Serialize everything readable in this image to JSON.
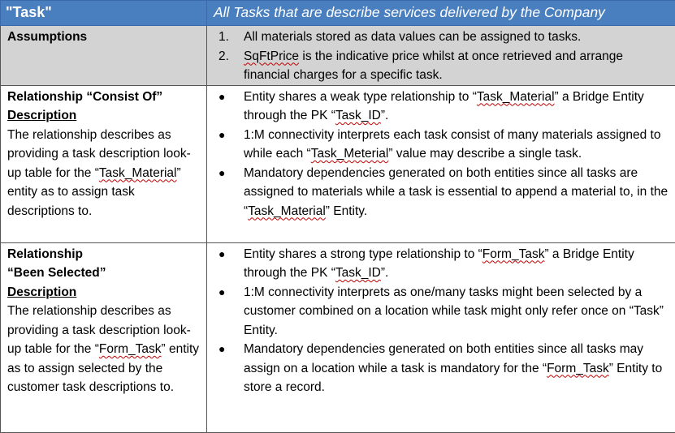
{
  "header": {
    "entity": "\"Task\"",
    "summary": "All Tasks that are describe services delivered by the Company"
  },
  "assumptions": {
    "label": "Assumptions",
    "items": [
      {
        "num": "1.",
        "text": "All materials stored as data values can be assigned to tasks."
      },
      {
        "num": "2.",
        "pre": "",
        "term": "SqFtPrice",
        "post": " is the indicative price whilst at once retrieved and arrange financial charges for a specific task."
      }
    ]
  },
  "rel1": {
    "title": "Relationship “Consist Of”",
    "desc_heading": "Description",
    "desc_pre": "The relationship describes as providing a task description look-up table for the “",
    "desc_term": "Task_Material",
    "desc_post": "” entity as to assign task descriptions to.",
    "bullets": [
      {
        "pre": "Entity shares a weak type relationship to “",
        "term": "Task_Material",
        "mid": "” a Bridge Entity through the PK “",
        "term2": "Task_ID",
        "post": "”."
      },
      {
        "pre": "1:M connectivity interprets each task consist of many materials assigned to while each “",
        "term": "Task_Meterial",
        "mid": "” value may describe a single task.",
        "term2": "",
        "post": ""
      },
      {
        "pre": "Mandatory dependencies generated on both entities since all tasks are assigned to materials while a task is essential to append a material to, in the “",
        "term": "Task_Material",
        "mid": "” Entity.",
        "term2": "",
        "post": ""
      }
    ]
  },
  "rel2": {
    "title_line1": "Relationship",
    "title_line2": "“Been Selected”",
    "desc_heading": "Description",
    "desc_pre": "The relationship describes as providing a task description look-up table for the “",
    "desc_term": "Form_Task",
    "desc_post": "” entity as to assign selected by the customer task descriptions to.",
    "bullets": [
      {
        "pre": "Entity shares a strong type relationship to “",
        "term": "Form_Task",
        "mid": "” a Bridge Entity through the PK “",
        "term2": "Task_ID",
        "post": "”."
      },
      {
        "pre": "1:M connectivity interprets as one/many tasks might been selected by a customer combined on a location while task might only refer once on “Task” Entity.",
        "term": "",
        "mid": "",
        "term2": "",
        "post": ""
      },
      {
        "pre": "Mandatory dependencies generated on both entities since all tasks may assign on a location while a task is mandatory for the “",
        "term": "Form_Task",
        "mid": "” Entity to store a record.",
        "term2": "",
        "post": ""
      }
    ]
  },
  "bullet_glyph": "●"
}
